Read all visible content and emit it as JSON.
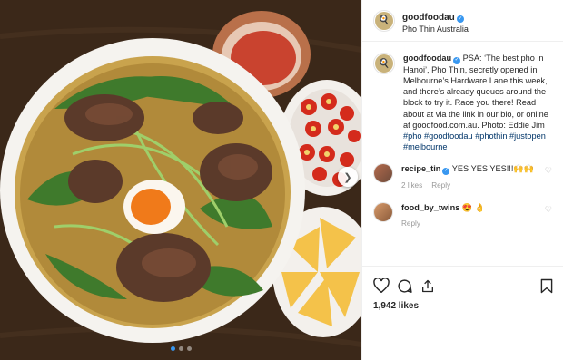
{
  "post": {
    "account": "goodfoodau",
    "location": "Pho Thin Australia",
    "likes": "1,942 likes"
  },
  "caption": {
    "username": "goodfoodau",
    "text": "PSA: ‘The best pho in Hanoi’, Pho Thin, secretly opened in Melbourne’s Hardware Lane this week, and there’s already queues around the block to try it. Race you there! Read about at via the link in our bio, or online at goodfood.com.au. Photo: Eddie Jim",
    "hashtags": "#pho #goodfoodau #phothin #justopen #melbourne"
  },
  "comments": [
    {
      "username": "recipe_tin",
      "text": "YES YES YES!!!🙌🙌",
      "likes": "2 likes",
      "reply": "Reply",
      "verified": true
    },
    {
      "username": "food_by_twins",
      "text": "😍 👌",
      "reply": "Reply",
      "verified": false
    }
  ],
  "icons": {
    "like": "heart-outline-icon",
    "comment": "comment-bubble-icon",
    "share": "share-icon",
    "save": "bookmark-icon",
    "next": "chevron-right-icon"
  },
  "carousel": {
    "total": 3,
    "active": 1
  },
  "colors": {
    "accent": "#3897f0",
    "hashtag": "#003569",
    "text": "#262626",
    "muted": "#999999"
  }
}
